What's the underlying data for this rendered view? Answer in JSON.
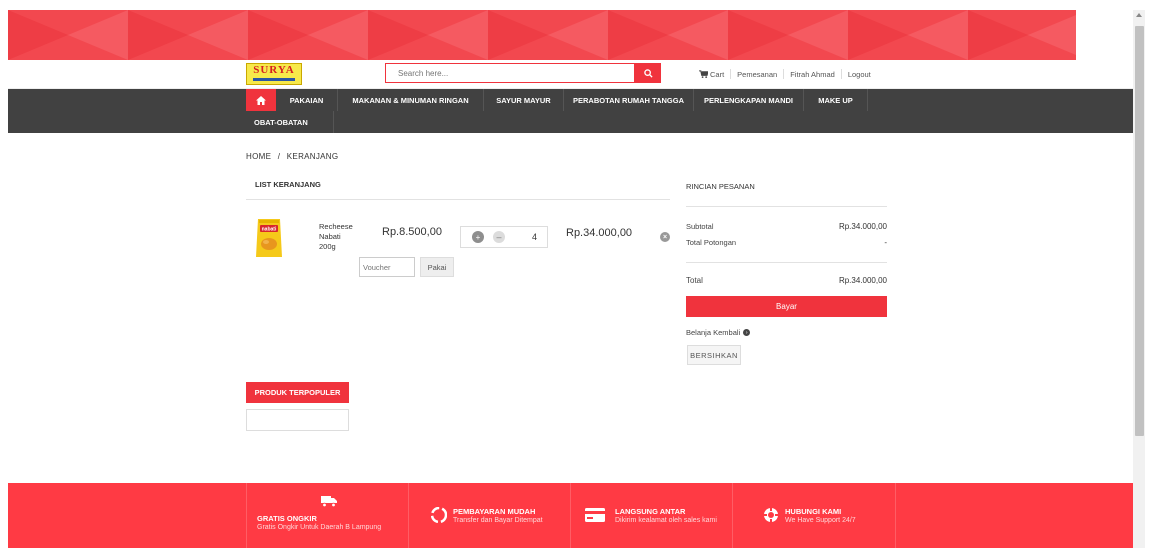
{
  "search": {
    "placeholder": "Search here..."
  },
  "logo": {
    "text": "SURYA"
  },
  "topnav": {
    "cart": "Cart",
    "orders": "Pemesanan",
    "user": "Fitrah Ahmad",
    "logout": "Logout"
  },
  "menu": {
    "items": [
      "PAKAIAN",
      "MAKANAN & MINUMAN RINGAN",
      "SAYUR MAYUR",
      "PERABOTAN RUMAH TANGGA",
      "PERLENGKAPAN MANDI",
      "MAKE UP",
      "OBAT-OBATAN"
    ]
  },
  "breadcrumb": {
    "home": "HOME",
    "separator": "/",
    "current": "KERANJANG"
  },
  "cart": {
    "title": "LIST KERANJANG",
    "item": {
      "name": "Recheese Nabati 200g",
      "image_label": "nabati",
      "price": "Rp.8.500,00",
      "quantity": "4",
      "subtotal": "Rp.34.000,00",
      "voucher_placeholder": "Voucher",
      "apply_label": "Pakai"
    }
  },
  "summary": {
    "title": "RINCIAN PESANAN",
    "subtotal_label": "Subtotal",
    "subtotal_value": "Rp.34.000,00",
    "discount_label": "Total Potongan",
    "discount_value": "-",
    "total_label": "Total",
    "total_value": "Rp.34.000,00",
    "pay_label": "Bayar",
    "continue_label": "Belanja Kembali",
    "clear_label": "BERSIHKAN"
  },
  "popular": {
    "label": "PRODUK TERPOPULER"
  },
  "footer": {
    "features": [
      {
        "title": "GRATIS ONGKIR",
        "sub": "Gratis Ongkir Untuk Daerah B Lampung",
        "icon": "truck-icon"
      },
      {
        "title": "PEMBAYARAN MUDAH",
        "sub": "Transfer dan Bayar Ditempat",
        "icon": "recycle-icon"
      },
      {
        "title": "LANGSUNG ANTAR",
        "sub": "Dikirim kealamat oleh sales kami",
        "icon": "credit-card-icon"
      },
      {
        "title": "HUBUNGI KAMI",
        "sub": "We Have Support 24/7",
        "icon": "lifebuoy-icon"
      }
    ]
  },
  "colors": {
    "accent": "#f0333d",
    "menubar": "#414141",
    "footer": "#ff3a44",
    "banner": "#f2484f"
  }
}
